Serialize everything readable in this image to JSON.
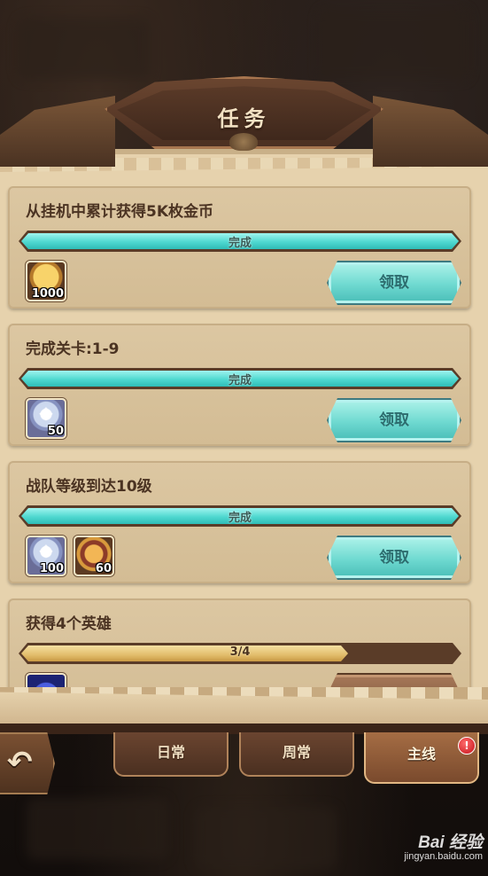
{
  "title": "任务",
  "tasks": [
    {
      "title": "从挂机中累计获得5K枚金币",
      "progress_label": "完成",
      "progress": 1.0,
      "rewards": [
        {
          "icon": "gold-coin-icon",
          "quantity": "1000"
        }
      ],
      "button_label": "领取",
      "claimable": true
    },
    {
      "title": "完成关卡:1-9",
      "progress_label": "完成",
      "progress": 1.0,
      "rewards": [
        {
          "icon": "diamond-icon",
          "quantity": "50"
        }
      ],
      "button_label": "领取",
      "claimable": true
    },
    {
      "title": "战队等级到达10级",
      "progress_label": "完成",
      "progress": 1.0,
      "rewards": [
        {
          "icon": "diamond-icon",
          "quantity": "100"
        },
        {
          "icon": "vip-badge-icon",
          "quantity": "60"
        }
      ],
      "button_label": "领取",
      "claimable": true
    },
    {
      "title": "获得4个英雄",
      "progress_label": "3/4",
      "progress": 0.75,
      "rewards": [
        {
          "icon": "hero-orb-icon",
          "quantity": ""
        }
      ],
      "button_label": "",
      "claimable": false
    }
  ],
  "tabs": [
    {
      "label": "日常",
      "active": false
    },
    {
      "label": "周常",
      "active": false
    },
    {
      "label": "主线",
      "active": true,
      "badge": "!"
    }
  ],
  "back_icon": "back-arrow-icon",
  "colors": {
    "complete_bar": "#4fd8d0",
    "partial_bar": "#e2bd6c",
    "claim_button": "#6ed9d0",
    "notification": "#c4121a"
  },
  "watermark": {
    "main": "Bai 经验",
    "sub": "jingyan.baidu.com"
  }
}
